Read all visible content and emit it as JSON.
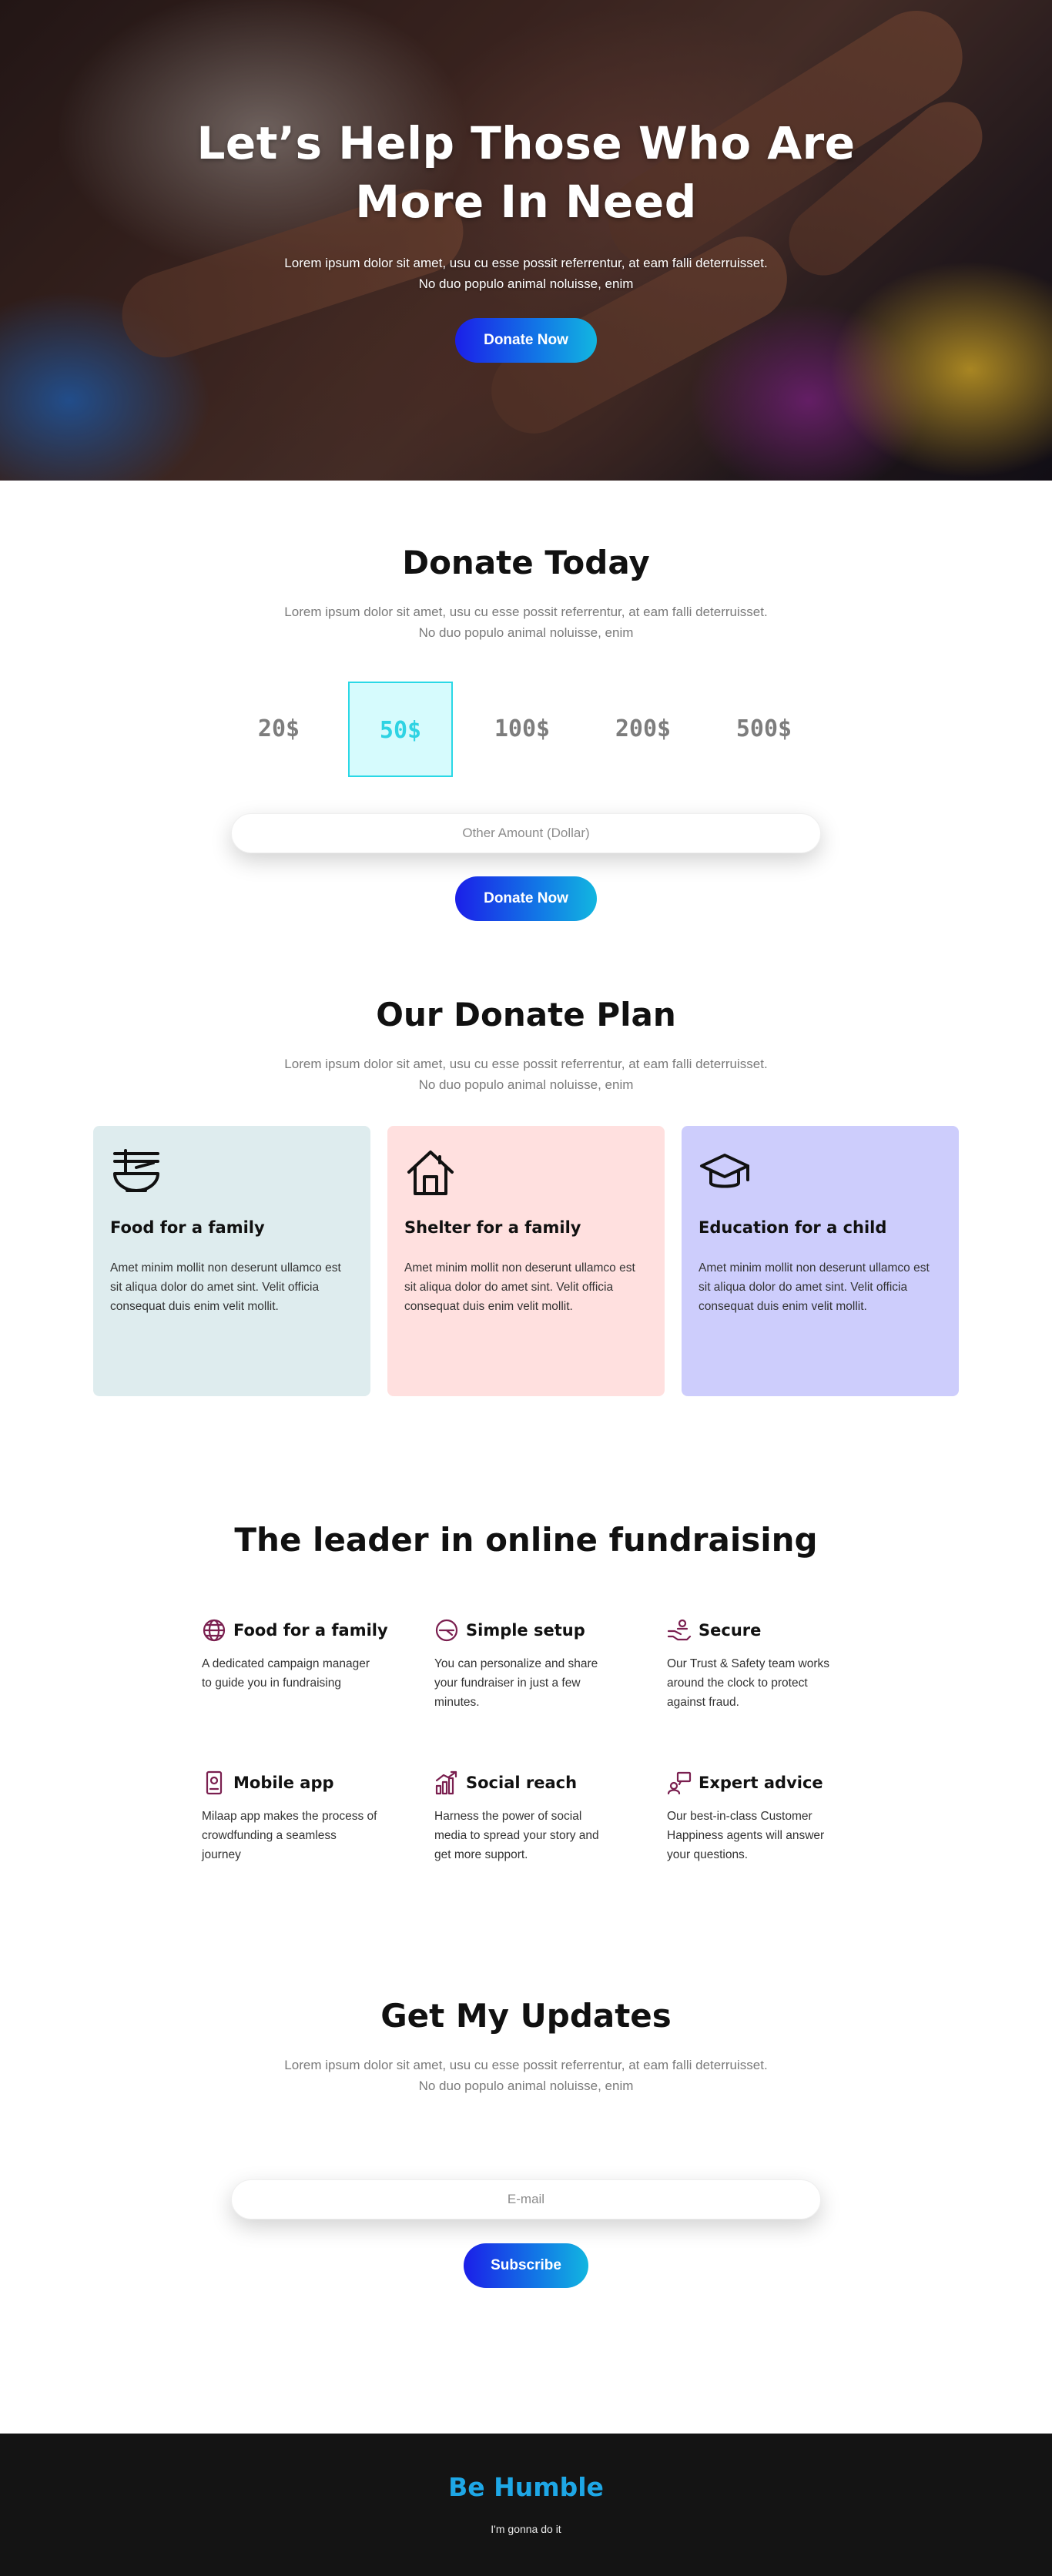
{
  "hero": {
    "title_line1": "Let’s Help Those Who Are",
    "title_line2": "More In Need",
    "subtitle": "Lorem ipsum dolor sit amet, usu cu esse possit referrentur, at eam falli deterruisset. No duo populo animal noluisse, enim",
    "button": "Donate Now"
  },
  "donate_today": {
    "title": "Donate Today",
    "subtitle": "Lorem ipsum dolor sit amet, usu cu esse possit referrentur, at eam falli deterruisset. No duo populo animal noluisse, enim",
    "amounts": [
      "20$",
      "50$",
      "100$",
      "200$",
      "500$"
    ],
    "selected_amount": "50$",
    "other_amount_placeholder": "Other Amount (Dollar)",
    "button": "Donate Now"
  },
  "donate_plan": {
    "title": "Our Donate Plan",
    "subtitle": "Lorem ipsum dolor sit amet, usu cu esse possit referrentur, at eam falli deterruisset. No duo populo animal noluisse, enim",
    "cards": [
      {
        "icon": "noodle-bowl-icon",
        "title": "Food for a family",
        "text": "Amet minim mollit non deserunt ullamco est sit aliqua dolor do amet sint. Velit officia consequat duis enim velit mollit.",
        "color": "#deecee"
      },
      {
        "icon": "house-icon",
        "title": "Shelter for a family",
        "text": "Amet minim mollit non deserunt ullamco est sit aliqua dolor do amet sint. Velit officia consequat duis enim velit mollit.",
        "color": "#ffe0df"
      },
      {
        "icon": "graduation-cap-icon",
        "title": "Education for a child",
        "text": "Amet minim mollit non deserunt ullamco est sit aliqua dolor do amet sint. Velit officia consequat duis enim velit mollit.",
        "color": "#cdcdfc"
      }
    ]
  },
  "leader": {
    "title": "The leader in online fundraising",
    "features": [
      {
        "icon": "globe-icon",
        "title": "Food for a family",
        "text": "A dedicated campaign manager to guide you in fundraising"
      },
      {
        "icon": "gauge-icon",
        "title": "Simple setup",
        "text": "You can personalize and share your fundraiser in just a few minutes."
      },
      {
        "icon": "hand-shield-icon",
        "title": "Secure",
        "text": "Our Trust & Safety team works around the clock to protect against fraud."
      },
      {
        "icon": "mobile-app-icon",
        "title": "Mobile app",
        "text": "Milaap app makes the process of crowdfunding a seamless journey"
      },
      {
        "icon": "growth-chart-icon",
        "title": "Social reach",
        "text": "Harness the power of social media to spread your story and get more support."
      },
      {
        "icon": "advisor-chat-icon",
        "title": "Expert advice",
        "text": "Our best-in-class Customer Happiness agents will answer your questions."
      }
    ],
    "icon_color": "#7a1f4f"
  },
  "updates": {
    "title": "Get My Updates",
    "subtitle": "Lorem ipsum dolor sit amet, usu cu esse possit referrentur, at eam falli deterruisset. No duo populo animal noluisse, enim",
    "email_placeholder": "E-mail",
    "button": "Subscribe"
  },
  "footer": {
    "brand": "Be Humble",
    "tagline": "I'm gonna do it"
  }
}
